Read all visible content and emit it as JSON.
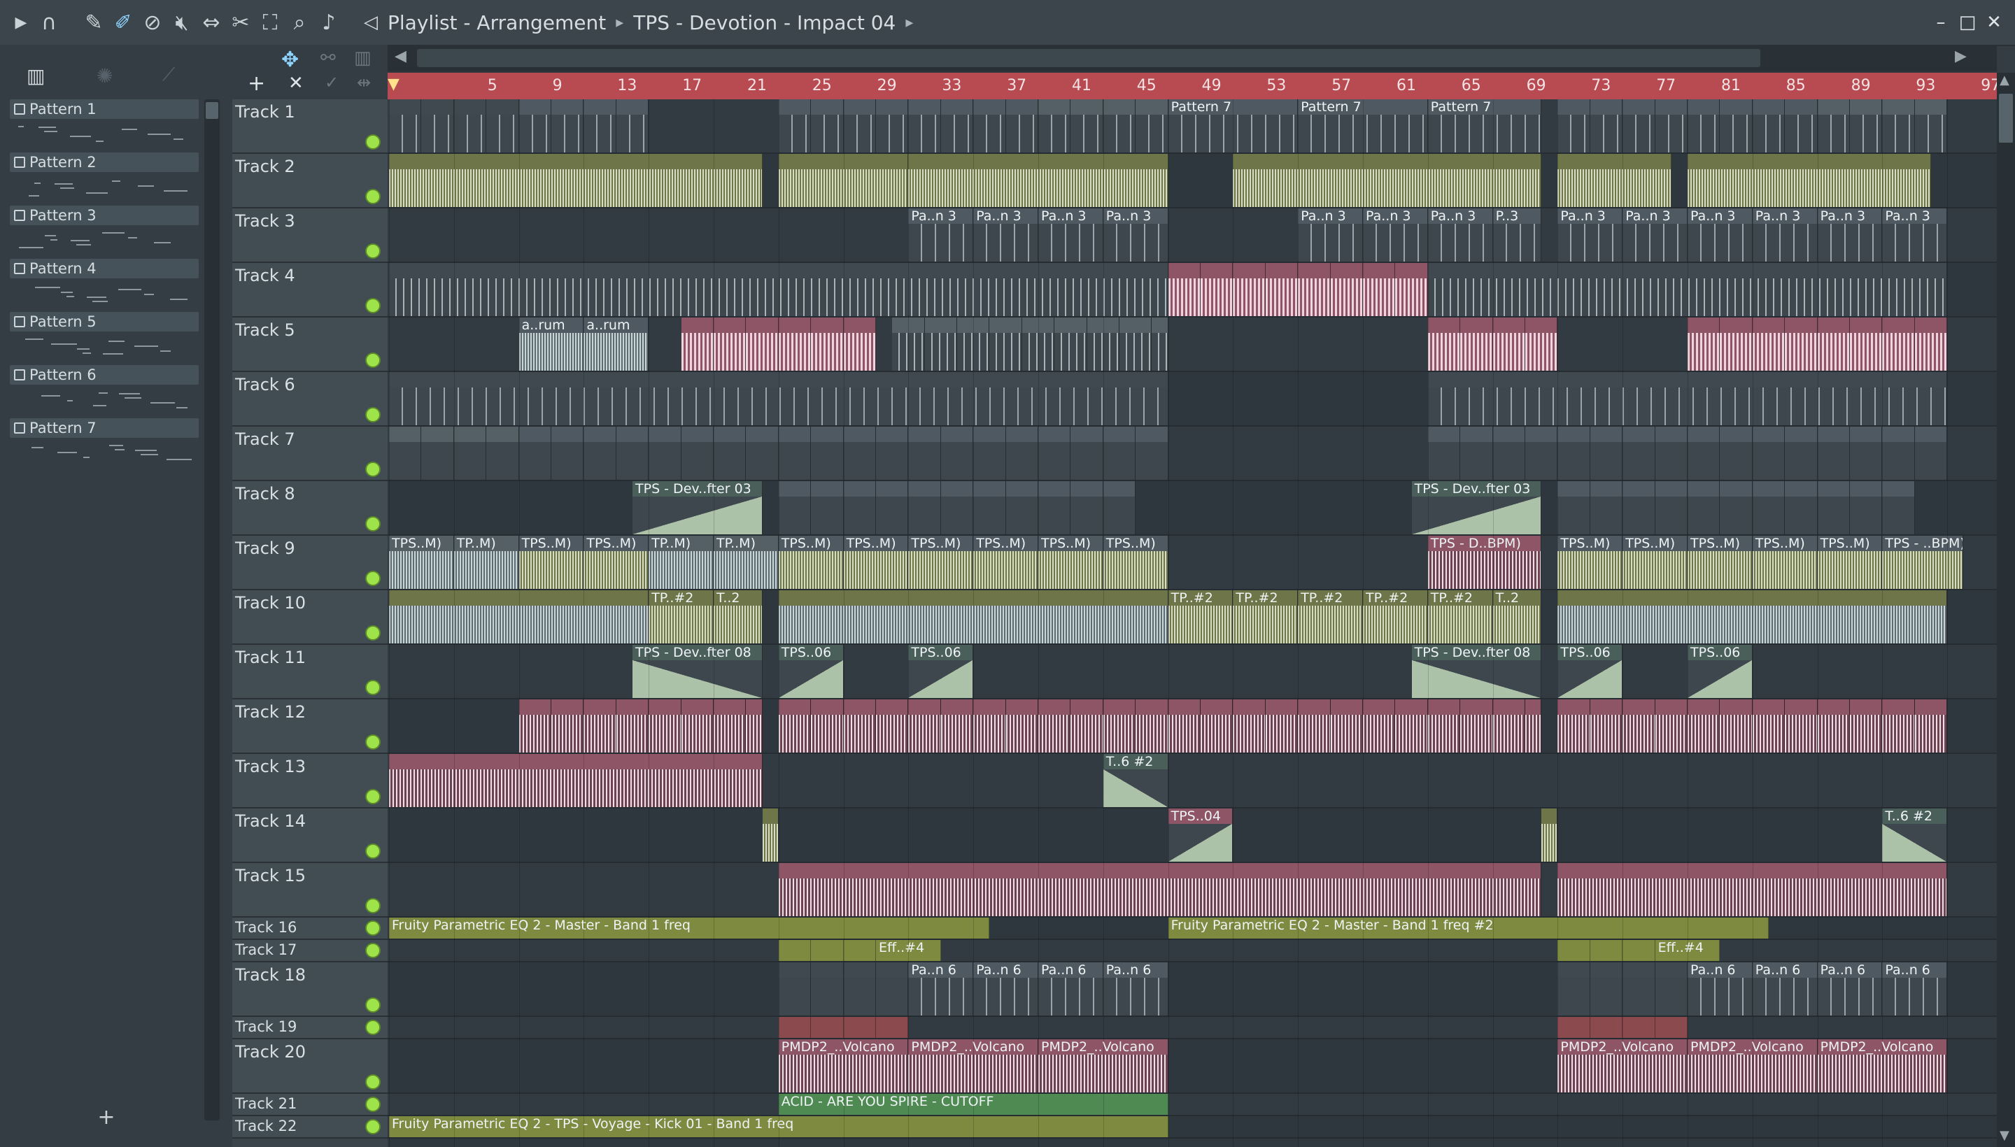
{
  "window": {
    "title_prefix": "Playlist - Arrangement",
    "song": "TPS - Devotion - Impact 04",
    "minimize": "–",
    "maximize": "□",
    "close": "✕"
  },
  "toolbar": {
    "icons": [
      "play-icon",
      "magnet-icon",
      "pencil-icon",
      "paint-icon",
      "delete-icon",
      "mute-icon",
      "slip-icon",
      "slice-icon",
      "select-icon",
      "zoom-icon",
      "speaker-icon",
      "back-icon"
    ]
  },
  "colors": {
    "accent": "#b84a52",
    "pattern_clip": "#4e5961",
    "audio_clip": "#6e7548",
    "pink_clip": "#8d5566",
    "automation_green": "#7d8a3f",
    "automation_red": "#8a4a4e",
    "active_led": "#9fe34a"
  },
  "browser": {
    "patterns": [
      "Pattern 1",
      "Pattern 2",
      "Pattern 3",
      "Pattern 4",
      "Pattern 5",
      "Pattern 6",
      "Pattern 7"
    ],
    "add": "+"
  },
  "track_tools": {
    "add": "+",
    "remove": "✕"
  },
  "ruler": {
    "bars": [
      "5",
      "9",
      "13",
      "17",
      "21",
      "25",
      "29",
      "33",
      "37",
      "41",
      "45",
      "49",
      "53",
      "57",
      "61",
      "65",
      "69",
      "73",
      "77",
      "81",
      "85",
      "89",
      "93",
      "97"
    ]
  },
  "tracks": [
    {
      "name": "Track 1"
    },
    {
      "name": "Track 2"
    },
    {
      "name": "Track 3"
    },
    {
      "name": "Track 4"
    },
    {
      "name": "Track 5"
    },
    {
      "name": "Track 6"
    },
    {
      "name": "Track 7"
    },
    {
      "name": "Track 8"
    },
    {
      "name": "Track 9"
    },
    {
      "name": "Track 10"
    },
    {
      "name": "Track 11"
    },
    {
      "name": "Track 12"
    },
    {
      "name": "Track 13"
    },
    {
      "name": "Track 14"
    },
    {
      "name": "Track 15"
    },
    {
      "name": "Track 16"
    },
    {
      "name": "Track 17"
    },
    {
      "name": "Track 18"
    },
    {
      "name": "Track 19"
    },
    {
      "name": "Track 20"
    },
    {
      "name": "Track 21"
    },
    {
      "name": "Track 22"
    }
  ],
  "clip_labels": {
    "pattern7": "Pattern 7",
    "pan3": "Pa..n 3",
    "p3": "P..3",
    "arum": "a..rum",
    "dev_after03": "TPS - Dev..fter 03",
    "tpsm": "TPS..M)",
    "tpm": "TP..M)",
    "tpsm_gray": "TPS..M)",
    "d_bpm": "TPS - D..BPM)",
    "end_bpm": "TPS - ..BPM)",
    "tp2": "TP..#2",
    "t2": "T..2",
    "dev_after08": "TPS - Dev..fter 08",
    "tps06": "TPS..06",
    "t6_2": "T..6 #2",
    "tps04": "TPS..04",
    "eq_band1": "Fruity Parametric EQ 2 - Master - Band 1 freq",
    "eq_band1_2": "Fruity Parametric EQ 2 - Master - Band 1 freq #2",
    "eff4": "Eff..#4",
    "pan6": "Pa..n 6",
    "volcano": "PMDP2_..Volcano",
    "acid": "ACID - ARE YOU SPIRE - CUTOFF",
    "voyage": "Fruity Parametric EQ 2 - TPS - Voyage - Kick 01 - Band 1 freq"
  }
}
